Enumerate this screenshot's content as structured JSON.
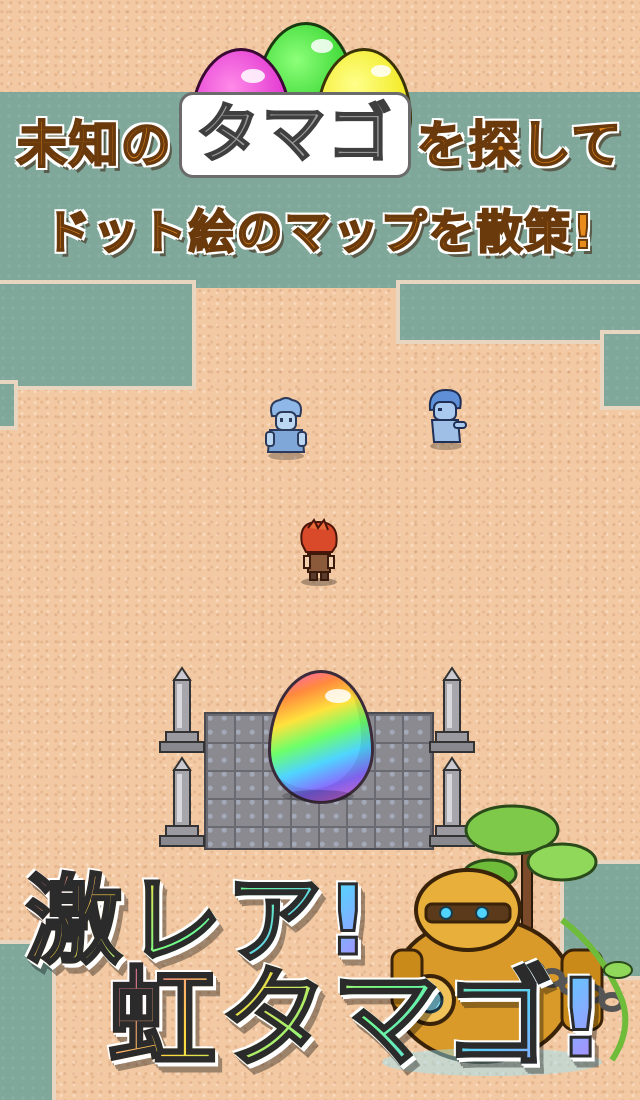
{
  "headline": {
    "line1_before": "未知の",
    "line1_box": "タマゴ",
    "line1_after": "を探して",
    "line2": "ドット絵のマップを散策!"
  },
  "promo": {
    "line1": "激レア!",
    "line2": "虹タマゴ!"
  },
  "colors": {
    "sand": "#f2c9a2",
    "water": "#7fa89b",
    "headline_orange": "#e88c1e",
    "egg_pink": "#e03fd0",
    "egg_green": "#3fe03a",
    "egg_yellow": "#f2f21a"
  },
  "sprites": [
    "blue-ghost-character",
    "blue-zombie-character",
    "red-haired-hero",
    "rainbow-egg",
    "stone-pillar",
    "golden-robot-with-tree"
  ]
}
